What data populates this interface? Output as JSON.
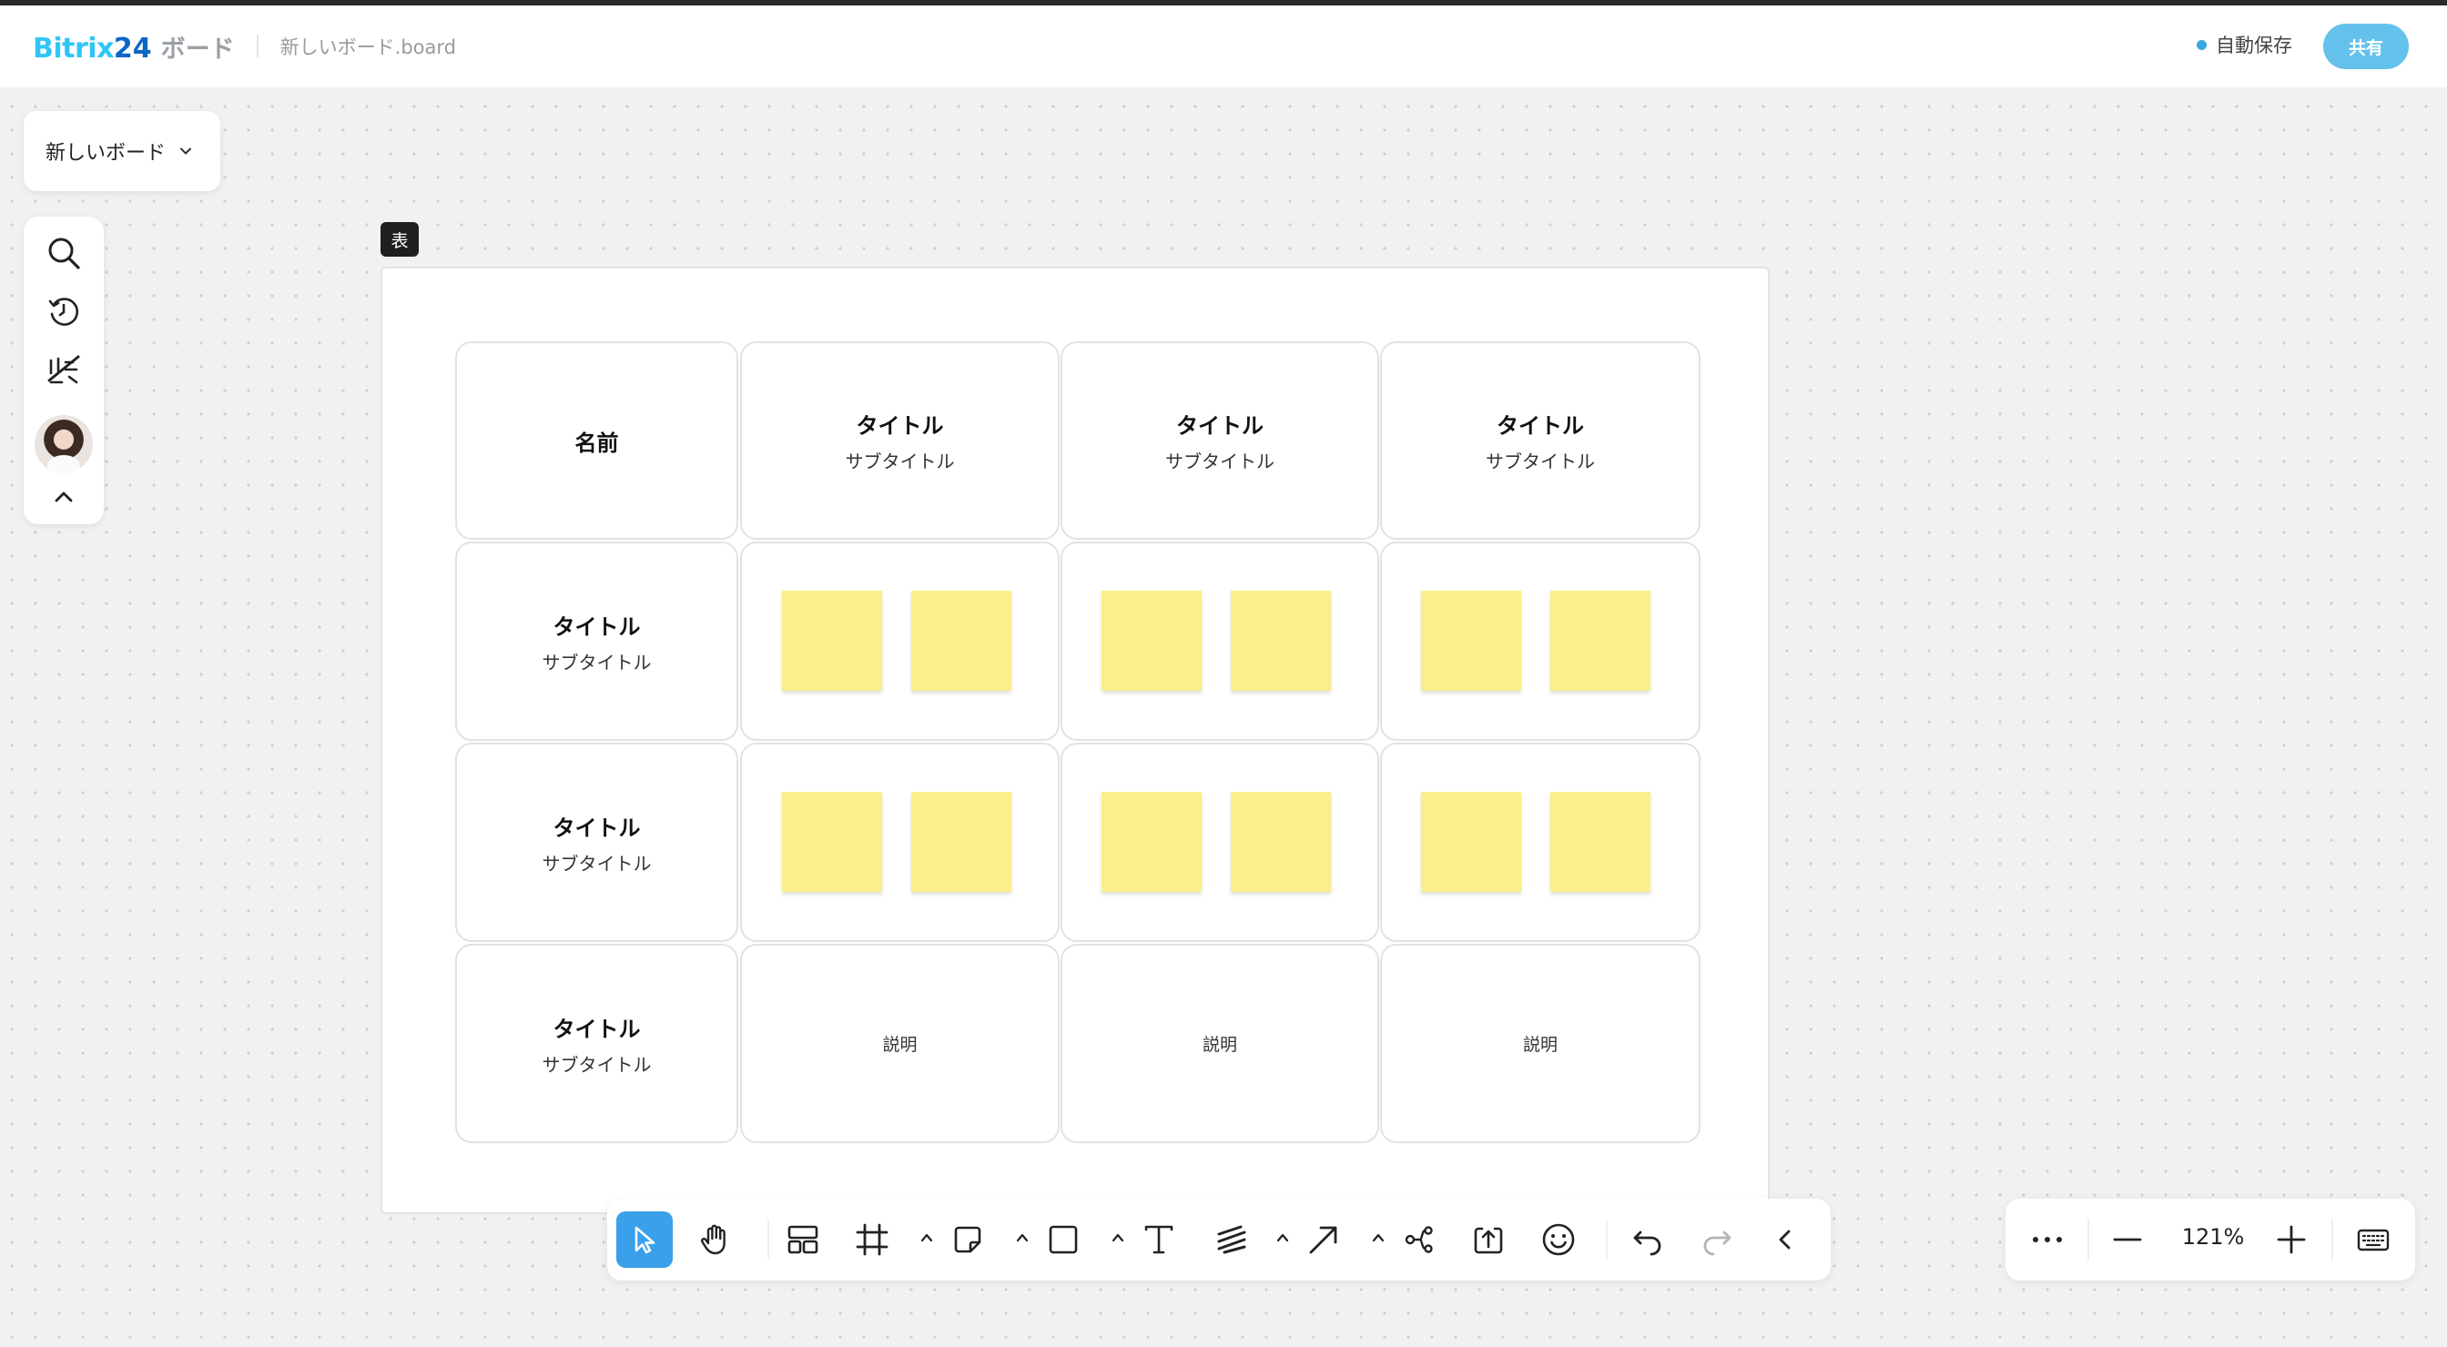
{
  "header": {
    "logo_part1": "Bitrix",
    "logo_part2": "24",
    "logo_part3": "ボード",
    "filename": "新しいボード.board",
    "autosave": "自動保存",
    "share": "共有"
  },
  "board_selector": {
    "label": "新しいボード"
  },
  "left_tools": [
    "search-icon",
    "history-icon",
    "magic-icon",
    "avatar",
    "collapse-icon"
  ],
  "frame": {
    "label": "表"
  },
  "table": {
    "header_row": {
      "name": "名前",
      "columns": [
        {
          "title": "タイトル",
          "subtitle": "サブタイトル"
        },
        {
          "title": "タイトル",
          "subtitle": "サブタイトル"
        },
        {
          "title": "タイトル",
          "subtitle": "サブタイトル"
        }
      ]
    },
    "rows": [
      {
        "title": "タイトル",
        "subtitle": "サブタイトル"
      },
      {
        "title": "タイトル",
        "subtitle": "サブタイトル"
      },
      {
        "title": "タイトル",
        "subtitle": "サブタイトル"
      }
    ],
    "descriptions": [
      "説明",
      "説明",
      "説明"
    ],
    "sticky_color": "#fbee8c"
  },
  "toolbar": {
    "tools": [
      "select-icon",
      "hand-icon",
      "template-icon",
      "frame-icon",
      "sticky-note-icon",
      "shape-icon",
      "text-icon",
      "pen-icon",
      "arrow-icon",
      "mindmap-icon",
      "upload-icon",
      "emoji-icon",
      "undo-icon",
      "redo-icon",
      "collapse-left-icon"
    ],
    "active_tool": "select-icon",
    "accent": "#3aa0ea"
  },
  "zoom": {
    "value": "121%"
  }
}
